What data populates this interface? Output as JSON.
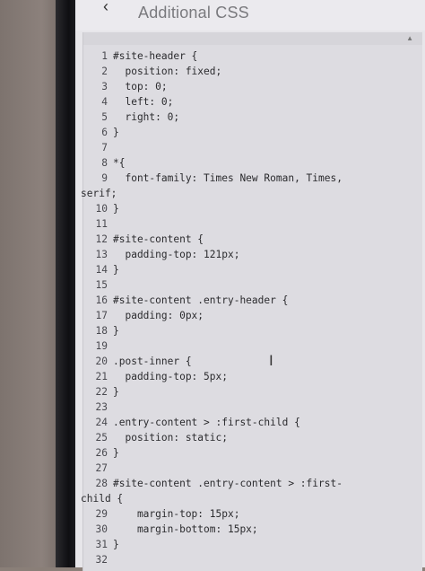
{
  "header": {
    "back_icon": "chevron-left-icon",
    "title": "Additional CSS"
  },
  "editor": {
    "lines": [
      {
        "n": "1",
        "text": "#site-header {"
      },
      {
        "n": "2",
        "text": "  position: fixed;"
      },
      {
        "n": "3",
        "text": "  top: 0;"
      },
      {
        "n": "4",
        "text": "  left: 0;"
      },
      {
        "n": "5",
        "text": "  right: 0;"
      },
      {
        "n": "6",
        "text": "}"
      },
      {
        "n": "7",
        "text": ""
      },
      {
        "n": "8",
        "text": "*{"
      },
      {
        "n": "9",
        "text": "  font-family: Times New Roman, Times,"
      },
      {
        "n": "",
        "text": "serif;"
      },
      {
        "n": "10",
        "text": "}"
      },
      {
        "n": "11",
        "text": ""
      },
      {
        "n": "12",
        "text": "#site-content {"
      },
      {
        "n": "13",
        "text": "  padding-top: 121px;"
      },
      {
        "n": "14",
        "text": "}"
      },
      {
        "n": "15",
        "text": ""
      },
      {
        "n": "16",
        "text": "#site-content .entry-header {"
      },
      {
        "n": "17",
        "text": "  padding: 0px;"
      },
      {
        "n": "18",
        "text": "}"
      },
      {
        "n": "19",
        "text": ""
      },
      {
        "n": "20",
        "text": ".post-inner {"
      },
      {
        "n": "21",
        "text": "  padding-top: 5px;"
      },
      {
        "n": "22",
        "text": "}"
      },
      {
        "n": "23",
        "text": ""
      },
      {
        "n": "24",
        "text": ".entry-content > :first-child {"
      },
      {
        "n": "25",
        "text": "  position: static;"
      },
      {
        "n": "26",
        "text": "}"
      },
      {
        "n": "27",
        "text": ""
      },
      {
        "n": "28",
        "text": "#site-content .entry-content > :first-"
      },
      {
        "n": "",
        "text": "child {"
      },
      {
        "n": "29",
        "text": "    margin-top: 15px;"
      },
      {
        "n": "30",
        "text": "    margin-bottom: 15px;"
      },
      {
        "n": "31",
        "text": "}"
      },
      {
        "n": "32",
        "text": ""
      }
    ]
  }
}
